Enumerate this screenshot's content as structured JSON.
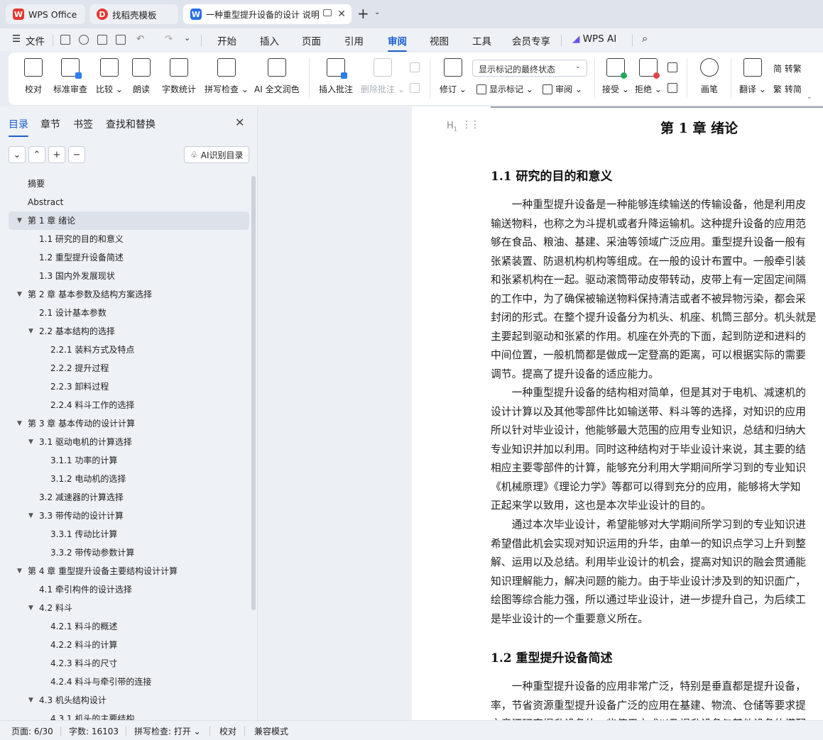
{
  "tabs": [
    {
      "label": "WPS Office",
      "logo": "W",
      "logo_color": "#e5372e",
      "state": "inactive"
    },
    {
      "label": "找稻壳模板",
      "logo": "D",
      "logo_color": "#e5372e",
      "state": "inactive"
    },
    {
      "label": "一种重型提升设备的设计 说明",
      "logo": "W",
      "logo_color": "#2a6ee8",
      "state": "active"
    }
  ],
  "menu": {
    "file": "文件",
    "items": [
      "开始",
      "插入",
      "页面",
      "引用",
      "审阅",
      "视图",
      "工具",
      "会员专享"
    ],
    "active": "审阅",
    "wps_ai": "WPS AI"
  },
  "ribbon": {
    "proofread": "校对",
    "standard_review": "标准审查",
    "compare": "比较",
    "read_aloud": "朗读",
    "word_count": "字数统计",
    "spell_check": "拼写检查",
    "ai_polish": "AI 全文润色",
    "insert_comment": "插入批注",
    "delete_comment": "删除批注",
    "track_changes": "修订",
    "display_mode": "显示标记的最终状态",
    "show_markup": "显示标记",
    "review_pane": "审阅",
    "accept": "接受",
    "reject": "拒绝",
    "pen": "画笔",
    "translate": "翻译",
    "to_traditional": "简 转繁",
    "to_simplified": "繁 转简",
    "ribbon_caret": "⌄"
  },
  "panel": {
    "tabs": [
      "目录",
      "章节",
      "书签",
      "查找和替换"
    ],
    "active_tab": "目录",
    "ai_toc": "AI识别目录",
    "toc": [
      {
        "text": "摘要",
        "level": 0,
        "expand": ""
      },
      {
        "text": "Abstract",
        "level": 0,
        "expand": ""
      },
      {
        "text": "第 1 章  绪论",
        "level": 0,
        "expand": "▼",
        "selected": true
      },
      {
        "text": "1.1 研究的目的和意义",
        "level": 1,
        "expand": ""
      },
      {
        "text": "1.2 重型提升设备简述",
        "level": 1,
        "expand": ""
      },
      {
        "text": "1.3 国内外发展现状",
        "level": 1,
        "expand": ""
      },
      {
        "text": "第 2 章  基本参数及结构方案选择",
        "level": 0,
        "expand": "▼"
      },
      {
        "text": "2.1 设计基本参数",
        "level": 1,
        "expand": ""
      },
      {
        "text": "2.2 基本结构的选择",
        "level": 1,
        "expand": "▼"
      },
      {
        "text": "2.2.1 装料方式及特点",
        "level": 2,
        "expand": ""
      },
      {
        "text": "2.2.2 提升过程",
        "level": 2,
        "expand": ""
      },
      {
        "text": "2.2.3 卸料过程",
        "level": 2,
        "expand": ""
      },
      {
        "text": "2.2.4 料斗工作的选择",
        "level": 2,
        "expand": ""
      },
      {
        "text": "第 3 章  基本传动的设计计算",
        "level": 0,
        "expand": "▼"
      },
      {
        "text": "3.1 驱动电机的计算选择",
        "level": 1,
        "expand": "▼"
      },
      {
        "text": "3.1.1 功率的计算",
        "level": 2,
        "expand": ""
      },
      {
        "text": "3.1.2 电动机的选择",
        "level": 2,
        "expand": ""
      },
      {
        "text": "3.2 减速器的计算选择",
        "level": 1,
        "expand": ""
      },
      {
        "text": "3.3 带传动的设计计算",
        "level": 1,
        "expand": "▼"
      },
      {
        "text": "3.3.1 传动比计算",
        "level": 2,
        "expand": ""
      },
      {
        "text": "3.3.2 带传动参数计算",
        "level": 2,
        "expand": ""
      },
      {
        "text": "第 4 章  重型提升设备主要结构设计计算",
        "level": 0,
        "expand": "▼"
      },
      {
        "text": "4.1 牵引构件的设计选择",
        "level": 1,
        "expand": ""
      },
      {
        "text": "4.2 料斗",
        "level": 1,
        "expand": "▼"
      },
      {
        "text": "4.2.1 料斗的概述",
        "level": 2,
        "expand": ""
      },
      {
        "text": "4.2.2 料斗的计算",
        "level": 2,
        "expand": ""
      },
      {
        "text": "4.2.3 料斗的尺寸",
        "level": 2,
        "expand": ""
      },
      {
        "text": "4.2.4 料斗与牵引带的连接",
        "level": 2,
        "expand": ""
      },
      {
        "text": "4.3 机头结构设计",
        "level": 1,
        "expand": "▼"
      },
      {
        "text": "4.3.1 机头的主要结构",
        "level": 2,
        "expand": ""
      }
    ]
  },
  "document": {
    "heading_marker": "H",
    "chapter_title": "第 1 章  绪论",
    "section1_title": "1.1 研究的目的和意义",
    "para1": [
      "　　一种重型提升设备是一种能够连续输送的传输设备，他是利用皮",
      "输送物料，也称之为斗提机或者升降运输机。这种提升设备的应用范",
      "够在食品、粮油、基建、采油等领域广泛应用。重型提升设备一般有",
      "张紧装置、防退机构机构等组成。在一般的设计布置中。一般牵引装",
      "和张紧机构在一起。驱动滚筒带动皮带转动，皮带上有一定固定间隔",
      "的工作中，为了确保被输送物料保持清洁或者不被异物污染，都会采",
      "封闭的形式。在整个提升设备分为机头、机座、机筒三部分。机头就是",
      "主要起到驱动和张紧的作用。机座在外壳的下面，起到防逆和进料的",
      "中间位置，一般机筒都是做成一定登高的距离，可以根据实际的需要",
      "调节。提高了提升设备的适应能力。"
    ],
    "para2": [
      "　　一种重型提升设备的结构相对简单，但是其对于电机、减速机的",
      "设计计算以及其他零部件比如输送带、料斗等的选择，对知识的应用",
      "所以针对毕业设计，他能够最大范围的应用专业知识，总结和归纳大",
      "专业知识并加以利用。同时这种结构对于毕业设计来说，其主要的结",
      "相应主要零部件的计算，能够充分利用大学期间所学习到的专业知识",
      "《机械原理》《理论力学》等都可以得到充分的应用，能够将大学知",
      "正起来学以致用，这也是本次毕业设计的目的。"
    ],
    "para3": [
      "　　通过本次毕业设计，希望能够对大学期间所学习到的专业知识进",
      "希望借此机会实现对知识运用的升华，由单一的知识点学习上升到整",
      "解、运用以及总结。利用毕业设计的机会，提高对知识的融会贯通能",
      "知识理解能力，解决问题的能力。由于毕业设计涉及到的知识面广，",
      "绘图等综合能力强，所以通过毕业设计，进一步提升自己，为后续工",
      "是毕业设计的一个重要意义所在。"
    ],
    "section2_title": "1.2 重型提升设备简述",
    "para4": [
      "　　一种重型提升设备的应用非常广泛，特别是垂直都是提升设备，",
      "率，节省资源重型提升设备广泛的应用在基建、物流、仓储等要求提",
      "文章还研究提升设备的一些使用方式以及提升设备与其他设备的搭配"
    ]
  },
  "status": {
    "page": "页面: 6/30",
    "words": "字数: 16103",
    "spell": "拼写检查: 打开",
    "proof": "校对",
    "compat": "兼容模式"
  }
}
